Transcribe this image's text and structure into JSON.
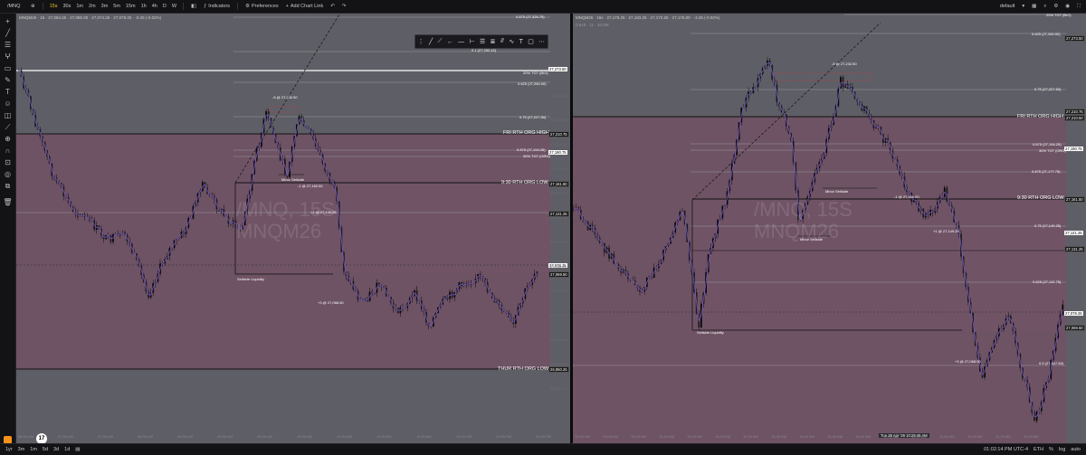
{
  "topbar": {
    "symbol": "/MNQ",
    "timeframes": [
      "15s",
      "30s",
      "1m",
      "2m",
      "3m",
      "5m",
      "15m",
      "1h",
      "4h",
      "D",
      "W"
    ],
    "active_timeframe": "15s",
    "indicators": "Indicators",
    "preferences": "Preferences",
    "add_chart_link": "Add Chart Link",
    "layout": "default"
  },
  "bottombar": {
    "ranges": [
      "1yr",
      "3m",
      "1m",
      "5d",
      "3d",
      "1d"
    ],
    "clock": "01:02:14 PM UTC-4",
    "session": "ETH",
    "pct": "%",
    "log": "log",
    "auto": "auto"
  },
  "left": {
    "legend": "MNQM26 · 15 · 27,084.25 · 27,085.00 · 27,074.25 · 27,078.25 · -0.25 (-0.02%)",
    "watermark_line1": "/MNQ, 15S",
    "watermark_line2": "MNQM26",
    "annotations": {
      "sell_5": "-5 @ 27,232.50",
      "sell_1a": "-1 @ 27,160.50",
      "sell_1b": "+1 @ 27,149.25",
      "buy_3": "+3 @ 27,068.50",
      "minor_sellside": "Minor Sellside",
      "sellside_liq": "Sellside Liquidity"
    },
    "levels": {
      "l0875top": "0.875 (27,326.75)",
      "l1": "0.1 (27,292.42)",
      "tgt20": "20% TGT (BIG)",
      "l0625": "0.625 (27,260.00)",
      "l075": "0.75 (27,227.50)",
      "fri_high": "FRI RTH ORG HIGH",
      "l0875": "0.875 (27,194.25)",
      "tgt30": "30% TGT (ORG)",
      "rth_low": "9:30 RTH ORG LOW",
      "thur_low": "THUR RTH ORG LOW"
    },
    "price_tags": {
      "p1": "27,273.50",
      "p2": "27,210.75",
      "p3": "27,190.75",
      "p4": "27,161.50",
      "p5": "27,131.25",
      "p6": "27,078.25",
      "p7": "27,069.50",
      "p8": "26,950.25"
    },
    "y_ticks": [
      "27,250.00",
      "27,225.00",
      "27,200.00",
      "27,175.00",
      "27,150.00",
      "27,125.00",
      "27,100.00",
      "27,050.00",
      "27,025.00",
      "27,000.00",
      "26,975.00",
      "26,925.00",
      "26,900.00"
    ],
    "x_ticks": [
      "06:30 AM",
      "07:00 AM",
      "07:30 AM",
      "08:00 AM",
      "08:30 AM",
      "09:00 AM",
      "09:30 AM",
      "10:00 AM",
      "10:30 AM",
      "11:00 AM",
      "11:30 AM",
      "12:00 PM",
      "12:30 PM",
      "01:00 PM"
    ]
  },
  "right": {
    "legend": "MNQM26 · 15s · 27,179.25 · 27,183.25 · 27,173.25 · 27,176.00 · -3.25 (-0.02%)",
    "legend2": "0.618 · 11 · 16.0M",
    "watermark_line1": "/MNQ, 15S",
    "watermark_line2": "MNQM26",
    "annotations": {
      "sell_5": "-5 @ 27,232.50",
      "sell_1a": "-1 @ 27,160.50",
      "sell_1b": "+1 @ 27,149.25",
      "buy_3": "+3 @ 27,068.50",
      "minor_sellside_a": "Minor Sellside",
      "minor_sellside_b": "Minor Sellside",
      "sellside_liq": "Sellside Liquidity"
    },
    "levels": {
      "tgt20": "20% TGT (BIG)",
      "l0625": "0.625 (27,260.00)",
      "l075": "0.75 (27,227.50)",
      "fri_high": "FRI RTH ORG HIGH",
      "l0875": "0.875 (27,194.25)",
      "tgt30": "30% TGT (ORG)",
      "l0875b": "0.875 (27,177.75)",
      "rth_low": "9:30 RTH ORG LOW",
      "l075b": "0.75 (27,149.25)",
      "l0625b": "0.625 (27,112.75)",
      "l05b": "0.5 (27,047.50)"
    },
    "price_tags": {
      "p0": "27,273.50",
      "p1": "27,210.75",
      "p2": "27,210.50",
      "p3": "27,190.75",
      "p4": "27,161.50",
      "p5": "27,141.25",
      "p6": "27,131.25",
      "p7": "27,078.25",
      "p8": "27,069.50"
    },
    "cross_time": "Tue 28 Apr '26  10:28:45 AM",
    "x_ticks": [
      "10:00 AM",
      "10:05 AM",
      "10:10 AM",
      "10:15 AM",
      "10:20 AM",
      "10:25 AM",
      "10:30 AM",
      "10:35 AM",
      "10:40 AM",
      "10:45 AM",
      "10:50 AM",
      "10:55 AM",
      "11:00 AM",
      "11:05 AM",
      "11:10 AM",
      "11:15 AM",
      "11:20 AM"
    ]
  },
  "colors": {
    "pink_zone": "#6e5364",
    "gray_zone": "#5e5e66",
    "candle_up": "#0b0b0b",
    "ma_line": "#7b5cd6",
    "accent": "#f0c419"
  }
}
